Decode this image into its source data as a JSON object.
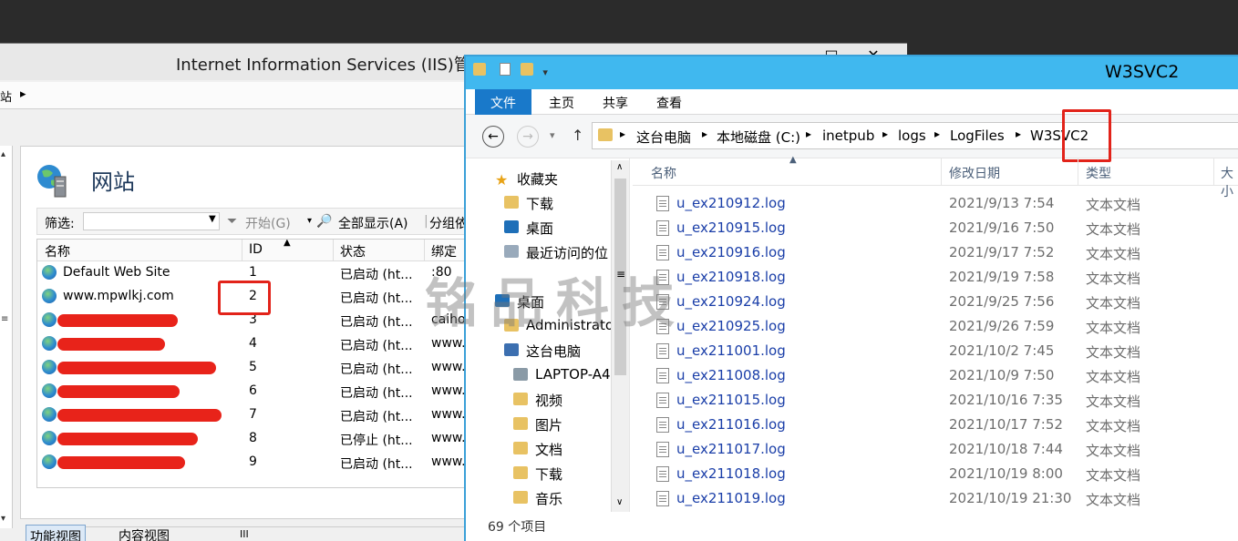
{
  "iis": {
    "title": "Internet Information Services (IIS)管理器",
    "window_controls": [
      "□",
      "✕"
    ],
    "nav_path_arrow": "▸",
    "section_title": "网站",
    "toolbar": {
      "filter_label": "筛选:",
      "start_label": "开始(G)",
      "show_all_label": "全部显示(A)",
      "group_label": "分组依"
    },
    "columns": [
      "名称",
      "ID",
      "状态",
      "绑定"
    ],
    "sites": [
      {
        "name": "Default Web Site",
        "id": "1",
        "status": "已启动 (ht...",
        "binding": ":80"
      },
      {
        "name": "www.mpwlkj.com",
        "id": "2",
        "status": "已启动 (ht...",
        "binding": ""
      },
      {
        "name": "",
        "id": "3",
        "status": "已启动 (ht...",
        "binding": "caiho"
      },
      {
        "name": "",
        "id": "4",
        "status": "已启动 (ht...",
        "binding": "www."
      },
      {
        "name": "",
        "id": "5",
        "status": "已启动 (ht...",
        "binding": "www."
      },
      {
        "name": "",
        "id": "6",
        "status": "已启动 (ht...",
        "binding": "www."
      },
      {
        "name": "",
        "id": "7",
        "status": "已启动 (ht...",
        "binding": "www."
      },
      {
        "name": "",
        "id": "8",
        "status": "已停止 (ht...",
        "binding": "www."
      },
      {
        "name": "",
        "id": "9",
        "status": "已启动 (ht...",
        "binding": "www."
      }
    ],
    "bottom_tabs": [
      "功能视图",
      "内容视图"
    ],
    "scroll_mark": "III"
  },
  "explorer": {
    "title": "W3SVC2",
    "ribbon_tabs": [
      "文件",
      "主页",
      "共享",
      "查看"
    ],
    "breadcrumb": [
      "这台电脑",
      "本地磁盘 (C:)",
      "inetpub",
      "logs",
      "LogFiles",
      "W3SVC2"
    ],
    "nav_items": [
      {
        "label": "收藏夹",
        "icon": "star-icon"
      },
      {
        "label": "下载",
        "icon": "download-folder-icon"
      },
      {
        "label": "桌面",
        "icon": "desktop-icon"
      },
      {
        "label": "最近访问的位",
        "icon": "recent-icon"
      },
      {
        "label": "桌面",
        "icon": "desktop-icon"
      },
      {
        "label": "Administrato",
        "icon": "user-folder-icon"
      },
      {
        "label": "这台电脑",
        "icon": "computer-icon"
      },
      {
        "label": "LAPTOP-A4",
        "icon": "network-drive-icon"
      },
      {
        "label": "视频",
        "icon": "video-folder-icon"
      },
      {
        "label": "图片",
        "icon": "pictures-folder-icon"
      },
      {
        "label": "文档",
        "icon": "documents-folder-icon"
      },
      {
        "label": "下载",
        "icon": "download-folder-icon"
      },
      {
        "label": "音乐",
        "icon": "music-folder-icon"
      }
    ],
    "columns": [
      "名称",
      "修改日期",
      "类型",
      "大小"
    ],
    "files": [
      {
        "name": "u_ex210912.log",
        "date": "2021/9/13 7:54",
        "type": "文本文档"
      },
      {
        "name": "u_ex210915.log",
        "date": "2021/9/16 7:50",
        "type": "文本文档"
      },
      {
        "name": "u_ex210916.log",
        "date": "2021/9/17 7:52",
        "type": "文本文档"
      },
      {
        "name": "u_ex210918.log",
        "date": "2021/9/19 7:58",
        "type": "文本文档"
      },
      {
        "name": "u_ex210924.log",
        "date": "2021/9/25 7:56",
        "type": "文本文档"
      },
      {
        "name": "u_ex210925.log",
        "date": "2021/9/26 7:59",
        "type": "文本文档"
      },
      {
        "name": "u_ex211001.log",
        "date": "2021/10/2 7:45",
        "type": "文本文档"
      },
      {
        "name": "u_ex211008.log",
        "date": "2021/10/9 7:50",
        "type": "文本文档"
      },
      {
        "name": "u_ex211015.log",
        "date": "2021/10/16 7:35",
        "type": "文本文档"
      },
      {
        "name": "u_ex211016.log",
        "date": "2021/10/17 7:52",
        "type": "文本文档"
      },
      {
        "name": "u_ex211017.log",
        "date": "2021/10/18 7:44",
        "type": "文本文档"
      },
      {
        "name": "u_ex211018.log",
        "date": "2021/10/19 8:00",
        "type": "文本文档"
      },
      {
        "name": "u_ex211019.log",
        "date": "2021/10/19 21:30",
        "type": "文本文档"
      }
    ],
    "status_text": "69 个项目"
  },
  "watermark": "铭品科技",
  "colors": {
    "accent": "#40b8ef",
    "ribbon_active": "#1979ca",
    "highlight_box": "#e2231a",
    "link": "#1a3ea8"
  }
}
